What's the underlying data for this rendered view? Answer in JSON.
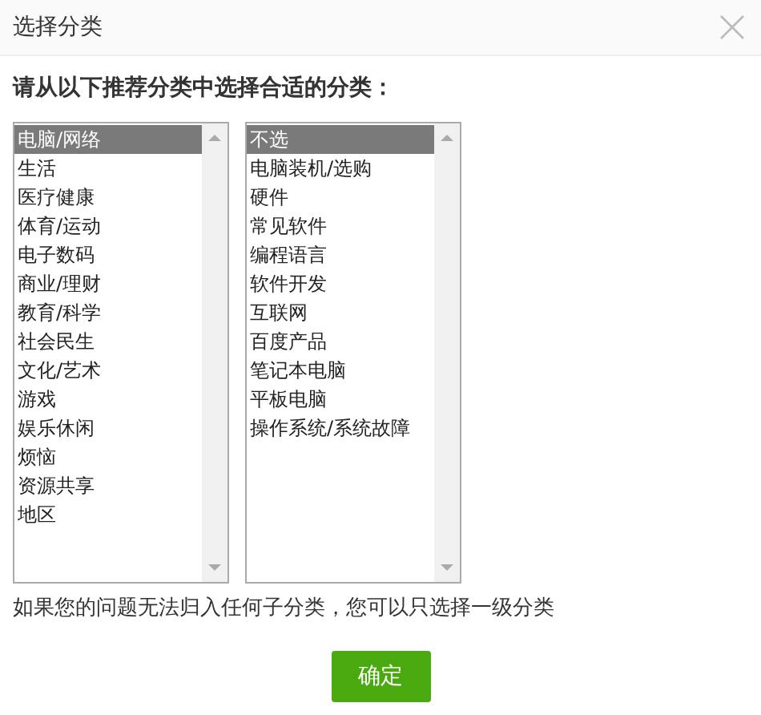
{
  "window": {
    "title": "选择分类"
  },
  "instruction": "请从以下推荐分类中选择合适的分类：",
  "lists": [
    {
      "items": [
        {
          "label": "电脑/网络",
          "selected": true
        },
        {
          "label": "生活",
          "selected": false
        },
        {
          "label": "医疗健康",
          "selected": false
        },
        {
          "label": "体育/运动",
          "selected": false
        },
        {
          "label": "电子数码",
          "selected": false
        },
        {
          "label": "商业/理财",
          "selected": false
        },
        {
          "label": "教育/科学",
          "selected": false
        },
        {
          "label": "社会民生",
          "selected": false
        },
        {
          "label": "文化/艺术",
          "selected": false
        },
        {
          "label": "游戏",
          "selected": false
        },
        {
          "label": "娱乐休闲",
          "selected": false
        },
        {
          "label": "烦恼",
          "selected": false
        },
        {
          "label": "资源共享",
          "selected": false
        },
        {
          "label": "地区",
          "selected": false
        }
      ]
    },
    {
      "items": [
        {
          "label": "不选",
          "selected": true
        },
        {
          "label": "电脑装机/选购",
          "selected": false
        },
        {
          "label": "硬件",
          "selected": false
        },
        {
          "label": "常见软件",
          "selected": false
        },
        {
          "label": "编程语言",
          "selected": false
        },
        {
          "label": "软件开发",
          "selected": false
        },
        {
          "label": "互联网",
          "selected": false
        },
        {
          "label": "百度产品",
          "selected": false
        },
        {
          "label": "笔记本电脑",
          "selected": false
        },
        {
          "label": "平板电脑",
          "selected": false
        },
        {
          "label": "操作系统/系统故障",
          "selected": false
        }
      ]
    }
  ],
  "hint": "如果您的问题无法归入任何子分类，您可以只选择一级分类",
  "buttons": [
    {
      "label": "确定",
      "kind": "primary"
    }
  ]
}
